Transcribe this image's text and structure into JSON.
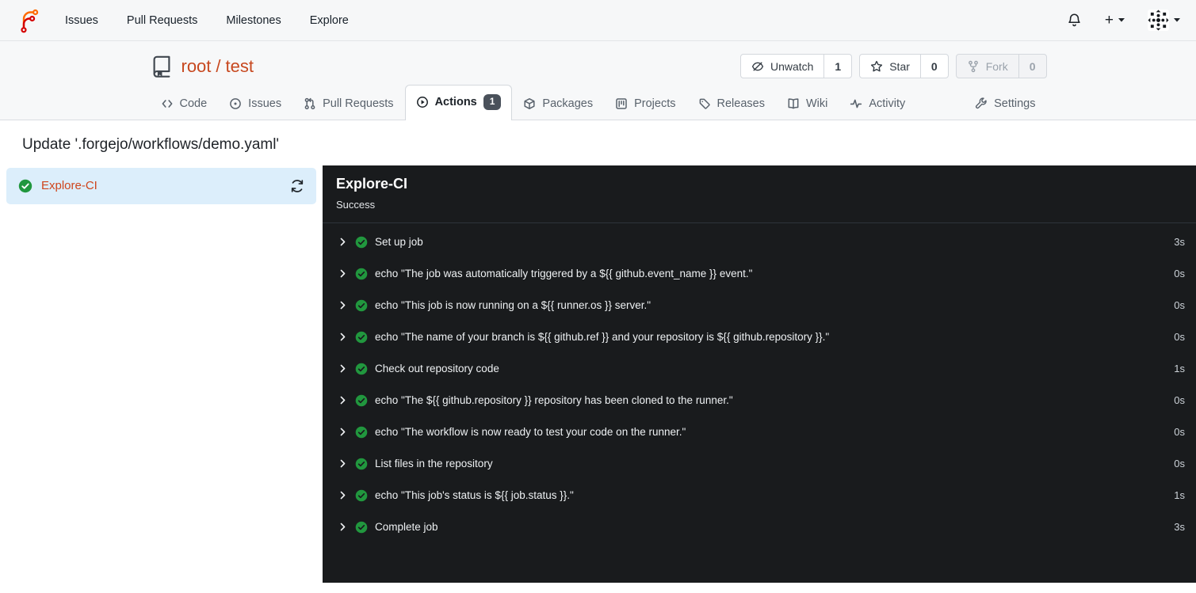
{
  "colors": {
    "accent_link": "#c7481f",
    "success_green": "#21973e",
    "panel_bg": "#191b1d",
    "selected_job_bg": "#dceefb",
    "badge_bg": "#4a515b"
  },
  "navbar": {
    "links": [
      "Issues",
      "Pull Requests",
      "Milestones",
      "Explore"
    ],
    "plus_label": "+"
  },
  "repo": {
    "owner": "root",
    "separator": "/",
    "name": "test",
    "actions": [
      {
        "label": "Unwatch",
        "count": "1"
      },
      {
        "label": "Star",
        "count": "0"
      },
      {
        "label": "Fork",
        "count": "0",
        "disabled": true
      }
    ]
  },
  "tabs": [
    {
      "label": "Code"
    },
    {
      "label": "Issues"
    },
    {
      "label": "Pull Requests"
    },
    {
      "label": "Actions",
      "badge": "1",
      "active": true
    },
    {
      "label": "Packages"
    },
    {
      "label": "Projects"
    },
    {
      "label": "Releases"
    },
    {
      "label": "Wiki"
    },
    {
      "label": "Activity"
    },
    {
      "label": "Settings"
    }
  ],
  "run": {
    "title": "Update '.forgejo/workflows/demo.yaml'",
    "job_name": "Explore-CI",
    "panel": {
      "title": "Explore-CI",
      "status": "Success"
    },
    "steps": [
      {
        "name": "Set up job",
        "duration": "3s"
      },
      {
        "name": "echo \"The job was automatically triggered by a ${{ github.event_name }} event.\"",
        "duration": "0s"
      },
      {
        "name": "echo \"This job is now running on a ${{ runner.os }} server.\"",
        "duration": "0s"
      },
      {
        "name": "echo \"The name of your branch is ${{ github.ref }} and your repository is ${{ github.repository }}.\"",
        "duration": "0s"
      },
      {
        "name": "Check out repository code",
        "duration": "1s"
      },
      {
        "name": "echo \"The ${{ github.repository }} repository has been cloned to the runner.\"",
        "duration": "0s"
      },
      {
        "name": "echo \"The workflow is now ready to test your code on the runner.\"",
        "duration": "0s"
      },
      {
        "name": "List files in the repository",
        "duration": "0s"
      },
      {
        "name": "echo \"This job's status is ${{ job.status }}.\"",
        "duration": "1s"
      },
      {
        "name": "Complete job",
        "duration": "3s"
      }
    ]
  }
}
